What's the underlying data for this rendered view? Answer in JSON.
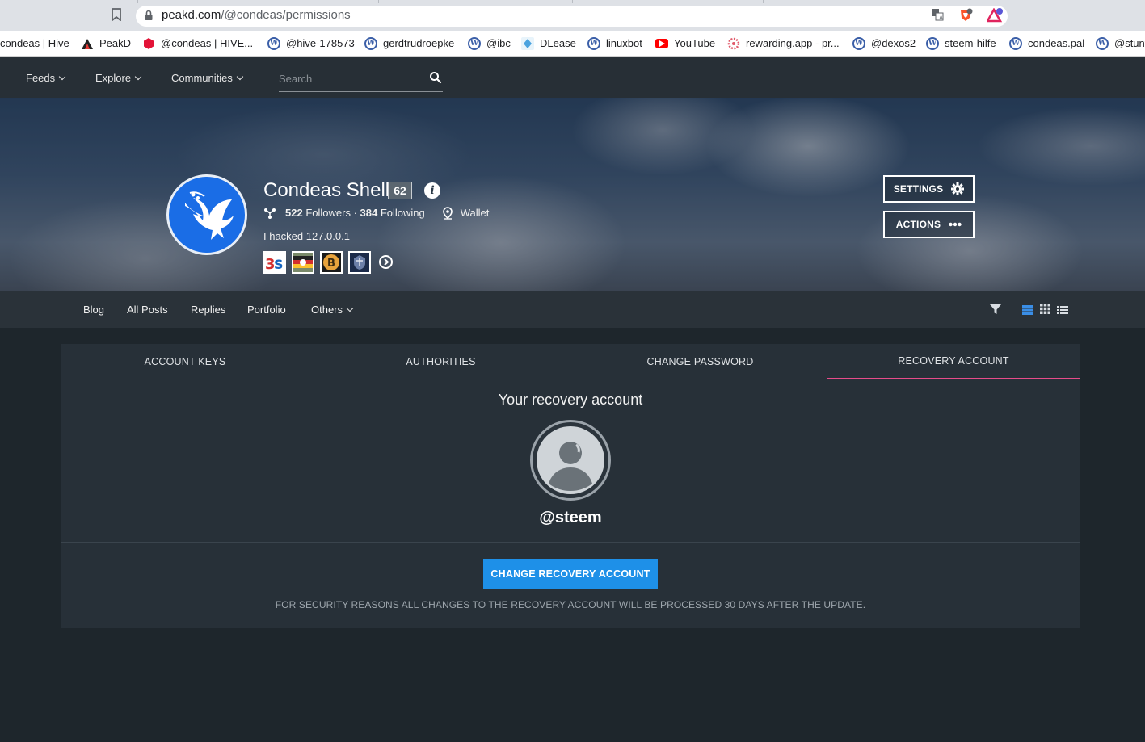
{
  "browser": {
    "url_host": "peakd.com",
    "url_path": "/@condeas/permissions"
  },
  "bookmarks": [
    {
      "label": "condeas | Hive",
      "icon": "none"
    },
    {
      "label": "PeakD",
      "icon": "peakd-icon"
    },
    {
      "label": "@condeas | HIVE...",
      "icon": "hive-icon"
    },
    {
      "label": "@hive-178573",
      "icon": "wordpress-icon"
    },
    {
      "label": "gerdtrudroepke",
      "icon": "wordpress-icon"
    },
    {
      "label": "@ibc",
      "icon": "wordpress-icon"
    },
    {
      "label": "DLease",
      "icon": "dlease-icon"
    },
    {
      "label": "linuxbot",
      "icon": "wordpress-icon"
    },
    {
      "label": "YouTube",
      "icon": "youtube-icon"
    },
    {
      "label": "rewarding.app - pr...",
      "icon": "rewarding-icon"
    },
    {
      "label": "@dexos2",
      "icon": "wordpress-icon"
    },
    {
      "label": "steem-hilfe",
      "icon": "wordpress-icon"
    },
    {
      "label": "condeas.pal",
      "icon": "wordpress-icon"
    },
    {
      "label": "@stunt",
      "icon": "wordpress-icon"
    }
  ],
  "nav": {
    "feeds": "Feeds",
    "explore": "Explore",
    "communities": "Communities",
    "search_placeholder": "Search"
  },
  "profile": {
    "name": "Condeas Shell",
    "reputation": "62",
    "followers_count": "522",
    "followers_label": "Followers",
    "following_count": "384",
    "following_label": "Following",
    "wallet_label": "Wallet",
    "about": "I hacked 127.0.0.1",
    "settings_label": "SETTINGS",
    "actions_label": "ACTIONS"
  },
  "subnav": {
    "blog": "Blog",
    "all_posts": "All Posts",
    "replies": "Replies",
    "portfolio": "Portfolio",
    "others": "Others"
  },
  "tabs": [
    {
      "label": "ACCOUNT KEYS",
      "active": false
    },
    {
      "label": "AUTHORITIES",
      "active": false
    },
    {
      "label": "CHANGE PASSWORD",
      "active": false
    },
    {
      "label": "RECOVERY ACCOUNT",
      "active": true
    }
  ],
  "recovery": {
    "title": "Your recovery account",
    "account": "@steem",
    "button": "CHANGE RECOVERY ACCOUNT",
    "note": "FOR SECURITY REASONS ALL CHANGES TO THE RECOVERY ACCOUNT WILL BE PROCESSED 30 DAYS AFTER THE UPDATE."
  },
  "colors": {
    "accent_pink": "#e64c8a",
    "primary_blue": "#1e90e8",
    "background": "#1e262c",
    "panel": "#273038"
  }
}
